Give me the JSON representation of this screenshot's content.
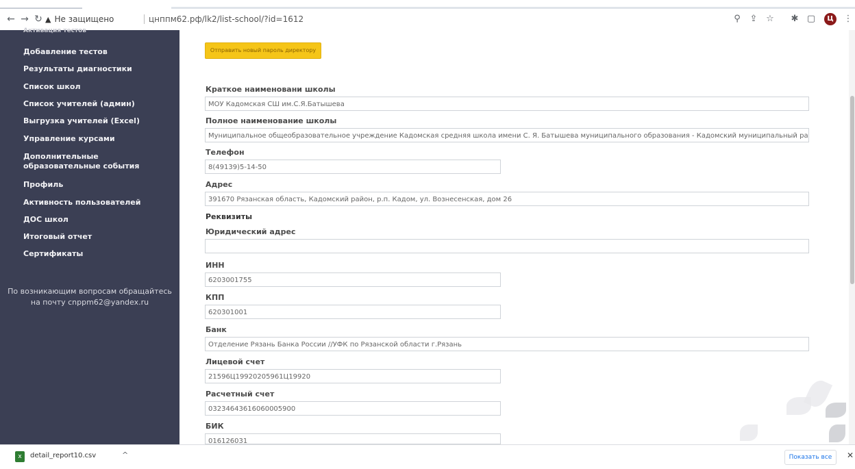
{
  "browser": {
    "security_label": "Не защищено",
    "url": "цнппм62.рф/lk2/list-school/?id=1612"
  },
  "sidebar": {
    "items": [
      {
        "label": "Активация тестов"
      },
      {
        "label": "Добавление тестов"
      },
      {
        "label": "Результаты диагностики"
      },
      {
        "label": "Список школ"
      },
      {
        "label": "Список учителей (админ)"
      },
      {
        "label": "Выгрузка учителей (Excel)"
      },
      {
        "label": "Управление курсами"
      },
      {
        "label": "Дополнительные",
        "label2": "образовательные события"
      },
      {
        "label": "Профиль"
      },
      {
        "label": "Активность пользователей"
      },
      {
        "label": "ДОС школ"
      },
      {
        "label": "Итоговый отчет"
      },
      {
        "label": "Сертификаты"
      }
    ],
    "help_line1": "По возникающим вопросам обращайтесь",
    "help_line2": "на почту cnppm62@yandex.ru"
  },
  "form": {
    "send_password_button": "Отправить новый пароль директору",
    "short_name_label": "Краткое наименовани школы",
    "short_name_value": "МОУ Кадомская СШ им.С.Я.Батышева",
    "full_name_label": "Полное наименование школы",
    "full_name_value": "Муниципальное общеобразовательное учреждение Кадомская средняя школа имени С. Я. Батышева муниципального образования - Кадомский муниципальный район Рязанской области",
    "phone_label": "Телефон",
    "phone_value": "8(49139)5-14-50",
    "address_label": "Адрес",
    "address_value": "391670 Рязанская область, Кадомский район, р.п. Кадом, ул. Вознесенская, дом 26",
    "requisites_title": "Реквизиты",
    "legal_address_label": "Юридический адрес",
    "legal_address_value": "",
    "inn_label": "ИНН",
    "inn_value": "6203001755",
    "kpp_label": "КПП",
    "kpp_value": "620301001",
    "bank_label": "Банк",
    "bank_value": "Отделение Рязань Банка России //УФК по Рязанской области г.Рязань",
    "personal_account_label": "Лицевой счет",
    "personal_account_value": "21596Ц19920205961Ц19920",
    "settlement_account_label": "Расчетный счет",
    "settlement_account_value": "03234643616060005900",
    "bik_label": "БИК",
    "bik_value": "016126031"
  },
  "downloads": {
    "file_name": "detail_report10.csv",
    "show_all": "Показать все"
  }
}
